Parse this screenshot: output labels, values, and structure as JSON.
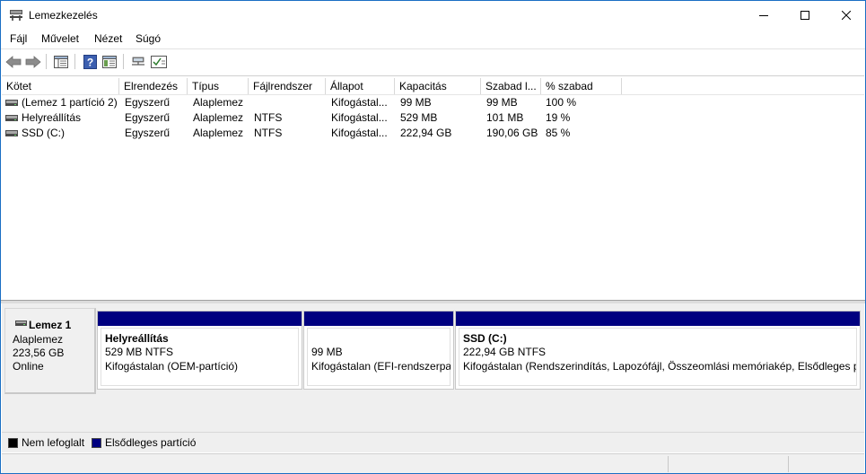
{
  "window": {
    "title": "Lemezkezelés"
  },
  "menu": {
    "items": [
      "Fájl",
      "Művelet",
      "Nézet",
      "Súgó"
    ]
  },
  "toolbar": {
    "icons": [
      "back-icon",
      "forward-icon",
      "console-tree-icon",
      "help-icon",
      "properties-icon",
      "connect-icon",
      "check-icon"
    ]
  },
  "volume_list": {
    "columns": [
      "Kötet",
      "Elrendezés",
      "Típus",
      "Fájlrendszer",
      "Állapot",
      "Kapacitás",
      "Szabad l...",
      "% szabad"
    ],
    "rows": [
      [
        "(Lemez 1 partíció 2)",
        "Egyszerű",
        "Alaplemez",
        "",
        "Kifogástal...",
        "99 MB",
        "99 MB",
        "100 %"
      ],
      [
        "Helyreállítás",
        "Egyszerű",
        "Alaplemez",
        "NTFS",
        "Kifogástal...",
        "529 MB",
        "101 MB",
        "19 %"
      ],
      [
        "SSD (C:)",
        "Egyszerű",
        "Alaplemez",
        "NTFS",
        "Kifogástal...",
        "222,94 GB",
        "190,06 GB",
        "85 %"
      ]
    ]
  },
  "disk": {
    "name": "Lemez 1",
    "type": "Alaplemez",
    "size": "223,56 GB",
    "status": "Online",
    "partitions": [
      {
        "name": "Helyreállítás",
        "size": "529 MB NTFS",
        "status": "Kifogástalan (OEM-partíció)"
      },
      {
        "name": "",
        "size": "99 MB",
        "status": "Kifogástalan (EFI-rendszerpar"
      },
      {
        "name": "SSD  (C:)",
        "size": "222,94 GB NTFS",
        "status": "Kifogástalan (Rendszerindítás, Lapozófájl, Összeomlási memóriakép, Elsődleges par"
      }
    ]
  },
  "legend": {
    "unallocated": "Nem lefoglalt",
    "primary": "Elsődleges partíció"
  },
  "colors": {
    "primary_partition": "#000080",
    "unallocated": "#000000",
    "window_border": "#1a6fc4"
  }
}
